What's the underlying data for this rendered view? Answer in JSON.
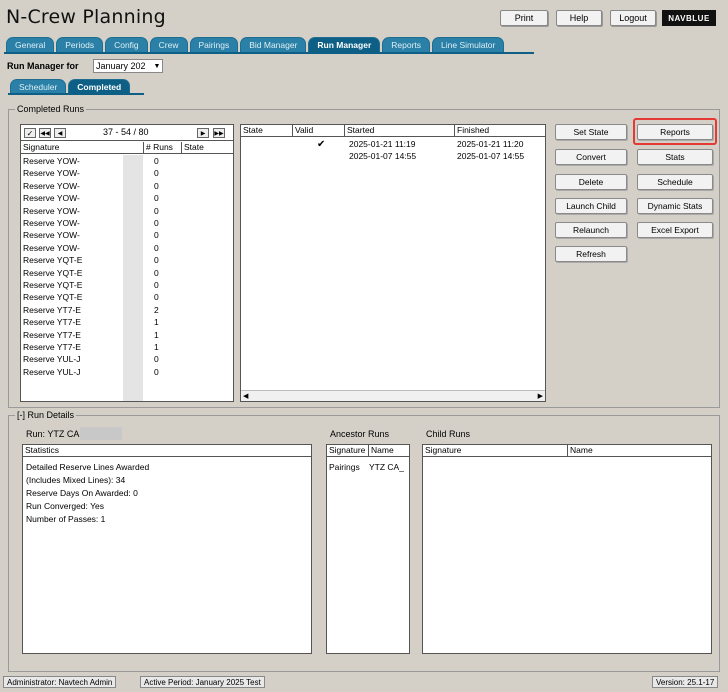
{
  "app": {
    "title": "N-Crew Planning",
    "logo": "NAVBLUE"
  },
  "topbar": {
    "print": "Print",
    "help": "Help",
    "logout": "Logout"
  },
  "main_tabs": [
    "General",
    "Periods",
    "Config",
    "Crew",
    "Pairings",
    "Bid Manager",
    "Run Manager",
    "Reports",
    "Line Simulator"
  ],
  "active_main_tab": "Run Manager",
  "run_manager": {
    "label": "Run Manager for",
    "period_value": "January 202"
  },
  "sub_tabs": [
    "Scheduler",
    "Completed"
  ],
  "active_sub_tab": "Completed",
  "completed_runs": {
    "legend": "Completed Runs",
    "pager": "37 - 54 / 80",
    "list_columns": [
      "Signature",
      "# Runs",
      "State"
    ],
    "rows": [
      {
        "signature": "Reserve YOW-",
        "runs": "0"
      },
      {
        "signature": "Reserve YOW-",
        "runs": "0"
      },
      {
        "signature": "Reserve YOW-",
        "runs": "0"
      },
      {
        "signature": "Reserve YOW-",
        "runs": "0"
      },
      {
        "signature": "Reserve YOW-",
        "runs": "0"
      },
      {
        "signature": "Reserve YOW-",
        "runs": "0"
      },
      {
        "signature": "Reserve YOW-",
        "runs": "0"
      },
      {
        "signature": "Reserve YOW-",
        "runs": "0"
      },
      {
        "signature": "Reserve YQT-E",
        "runs": "0"
      },
      {
        "signature": "Reserve YQT-E",
        "runs": "0"
      },
      {
        "signature": "Reserve YQT-E",
        "runs": "0"
      },
      {
        "signature": "Reserve YQT-E",
        "runs": "0"
      },
      {
        "signature": "Reserve YT7-E",
        "runs": "2"
      },
      {
        "signature": "Reserve YT7-E",
        "runs": "1"
      },
      {
        "signature": "Reserve YT7-E",
        "runs": "1"
      },
      {
        "signature": "Reserve YT7-E",
        "runs": "1"
      },
      {
        "signature": "Reserve YUL-J",
        "runs": "0"
      },
      {
        "signature": "Reserve YUL-J",
        "runs": "0"
      }
    ],
    "run_columns": [
      "State",
      "Valid",
      "Started",
      "Finished"
    ],
    "runs": [
      {
        "valid": "✔",
        "started": "2025-01-21 11:19",
        "finished": "2025-01-21 11:20"
      },
      {
        "valid": "",
        "started": "2025-01-07 14:55",
        "finished": "2025-01-07 14:55"
      }
    ],
    "buttons": {
      "set_state": "Set State",
      "reports": "Reports",
      "convert": "Convert",
      "stats": "Stats",
      "delete": "Delete",
      "schedule": "Schedule",
      "launch_child": "Launch Child",
      "dynamic_stats": "Dynamic Stats",
      "relaunch": "Relaunch",
      "excel_export": "Excel Export",
      "refresh": "Refresh"
    },
    "highlight_color": "#e53935"
  },
  "run_details": {
    "legend": "[-] Run Details",
    "run_label": "Run: YTZ CA",
    "statistics_header": "Statistics",
    "statistics": [
      "Detailed Reserve Lines Awarded",
      "(Includes Mixed Lines): 34",
      "Reserve Days On Awarded: 0",
      "Run Converged: Yes",
      "Number of Passes: 1"
    ],
    "ancestor_title": "Ancestor Runs",
    "ancestor_columns": [
      "Signature",
      "Name"
    ],
    "ancestor_rows": [
      {
        "signature": "Pairings",
        "name": "YTZ CA_"
      }
    ],
    "child_title": "Child Runs",
    "child_columns": [
      "Signature",
      "Name"
    ]
  },
  "status_bar": {
    "user": "Administrator: Navtech Admin",
    "period": "Active Period: January 2025 Test",
    "version": "Version: 25.1-17"
  }
}
